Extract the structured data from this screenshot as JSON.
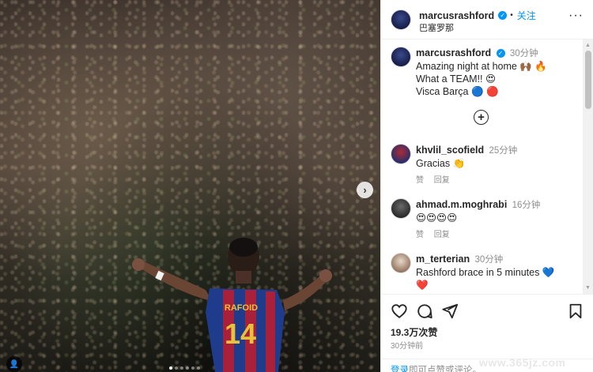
{
  "header": {
    "username": "marcusrashford",
    "follow_label": "关注",
    "location": "巴塞罗那",
    "more_label": "···"
  },
  "caption": {
    "username": "marcusrashford",
    "time": "30分钟",
    "lines": [
      "Amazing night at home 🙌🏾 🔥",
      "What a TEAM!! 😍",
      "Visca Barça 🔵 🔴"
    ]
  },
  "load_more_label": "+",
  "comments": [
    {
      "username": "khvlil_scofield",
      "time": "25分钟",
      "text": "Gracias 👏",
      "like_label": "赞",
      "reply_label": "回复"
    },
    {
      "username": "ahmad.m.moghrabi",
      "time": "16分钟",
      "text": "😍😍😍😍",
      "like_label": "赞",
      "reply_label": "回复"
    },
    {
      "username": "m_terterian",
      "time": "30分钟",
      "text": "Rashford brace in 5 minutes 💙",
      "text2": "❤️"
    }
  ],
  "stats": {
    "likes": "19.3万次赞",
    "posted": "30分钟前"
  },
  "login": {
    "link": "登录",
    "rest": "即可点赞或评论。"
  },
  "media": {
    "jersey_name": "RAFOID",
    "jersey_number": "14",
    "slide_count": 6,
    "active_slide": 0
  },
  "watermark": "www.365jz.com",
  "colors": {
    "link_blue": "#0095f6",
    "text_primary": "#262626",
    "text_secondary": "#8e8e8e",
    "jersey_blue": "#1f3b8c",
    "jersey_red": "#a8203a",
    "jersey_gold": "#e8c23a"
  }
}
